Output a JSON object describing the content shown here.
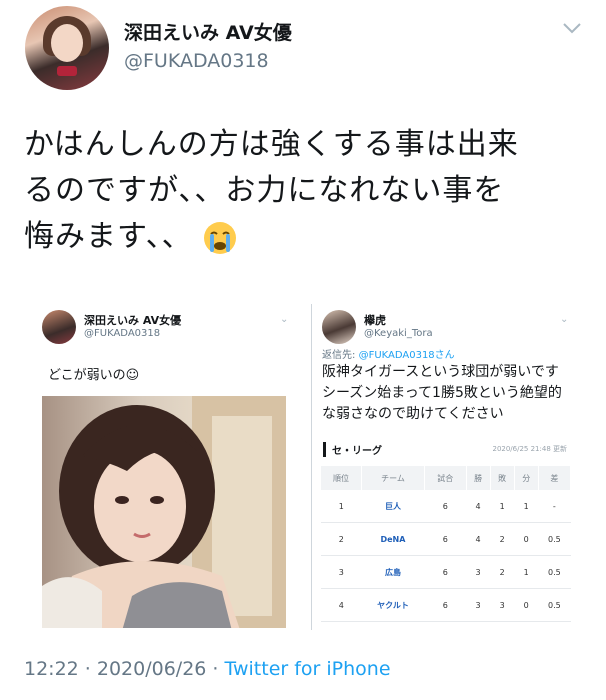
{
  "author": {
    "display_name": "深田えいみ AV女優",
    "handle": "@FUKADA0318"
  },
  "tweet": {
    "lines": [
      "かはんしんの方は強くする事は出来",
      "るのですが、、お力になれない事を",
      "悔みます、、"
    ],
    "emoji": "loudly-crying-face-icon"
  },
  "quoted_left": {
    "display_name": "深田えいみ AV女優",
    "handle": "@FUKADA0318",
    "text": "どこが弱いの☺"
  },
  "quoted_right": {
    "display_name": "欅虎",
    "handle": "@Keyaki_Tora",
    "reply_prefix": "返信先: ",
    "reply_handle": "@FUKADA0318さん",
    "lines": [
      "阪神タイガースという球団が弱いです",
      "シーズン始まって1勝5敗という絶望的",
      "な弱さなので助けてください"
    ]
  },
  "standings": {
    "title": "セ・リーグ",
    "updated": "2020/6/25 21:48 更新",
    "headers": [
      "順位",
      "チーム",
      "試合",
      "勝",
      "敗",
      "分",
      "差"
    ],
    "rows": [
      [
        "1",
        "巨人",
        "6",
        "4",
        "1",
        "1",
        "-"
      ],
      [
        "2",
        "DeNA",
        "6",
        "4",
        "2",
        "0",
        "0.5"
      ],
      [
        "3",
        "広島",
        "6",
        "3",
        "2",
        "1",
        "0.5"
      ],
      [
        "4",
        "ヤクルト",
        "6",
        "3",
        "3",
        "0",
        "0.5"
      ]
    ]
  },
  "meta": {
    "time": "12:22 · 2020/06/26 · ",
    "source": "Twitter for iPhone"
  },
  "colors": {
    "link": "#1da1f2",
    "muted": "#657786",
    "text": "#14171a"
  }
}
